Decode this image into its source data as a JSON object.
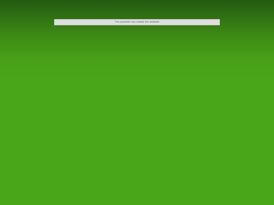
{
  "notice": {
    "message": "The provider has closed the website"
  },
  "colors": {
    "background_top": "#245a10",
    "background_main": "#4aa619",
    "notice_background": "#dedede",
    "notice_text": "#555555"
  }
}
